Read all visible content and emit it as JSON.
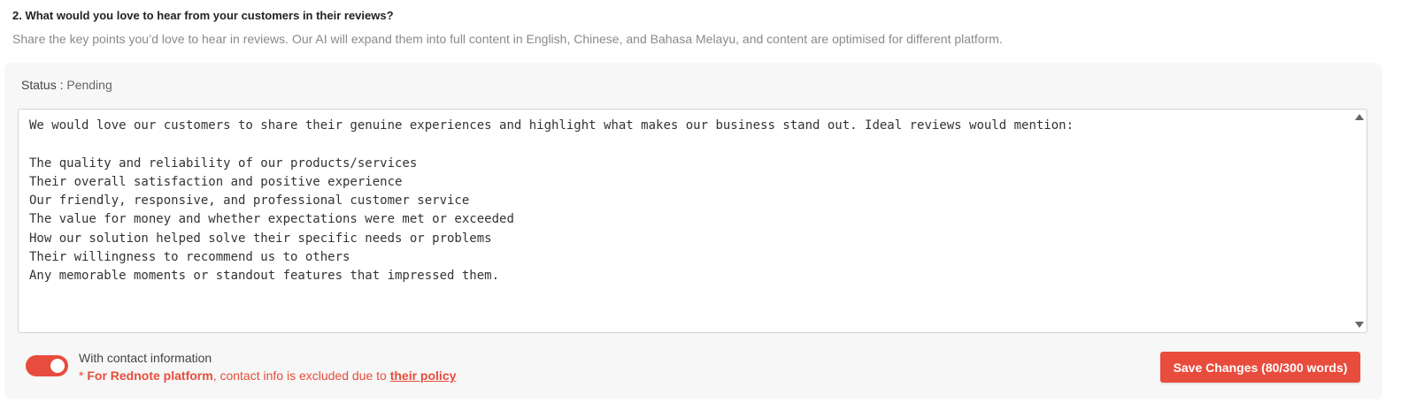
{
  "question": {
    "title": "2. What would you love to hear from your customers in their reviews?",
    "description": "Share the key points you’d love to hear in reviews. Our AI will expand them into full content in English, Chinese, and Bahasa Melayu, and content are optimised for different platform."
  },
  "status": {
    "label": "Status : ",
    "value": "Pending"
  },
  "review_points": {
    "value": "We would love our customers to share their genuine experiences and highlight what makes our business stand out. Ideal reviews would mention:\n\nThe quality and reliability of our products/services\nTheir overall satisfaction and positive experience\nOur friendly, responsive, and professional customer service\nThe value for money and whether expectations were met or exceeded\nHow our solution helped solve their specific needs or problems\nTheir willingness to recommend us to others\nAny memorable moments or standout features that impressed them."
  },
  "contact": {
    "toggle_on": true,
    "label": "With contact information",
    "note_prefix": "* ",
    "note_platform": "For Rednote platform",
    "note_middle": ", contact info is excluded due to ",
    "note_link": "their policy"
  },
  "save_button": {
    "label": "Save Changes (80/300 words)"
  },
  "colors": {
    "accent": "#e84c3d",
    "panel_bg": "#f6f7f6",
    "muted_text": "#8a8a8a"
  }
}
